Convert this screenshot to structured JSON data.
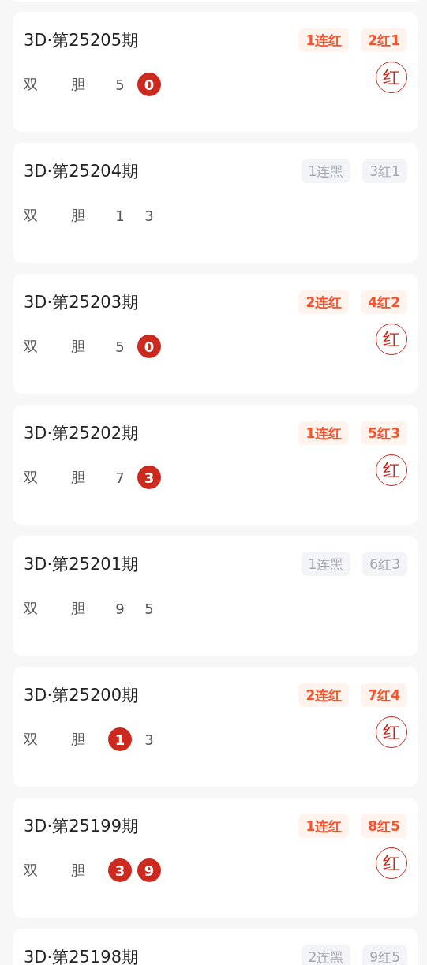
{
  "draws": [
    {
      "title": "3D·第25205期",
      "tags": [
        {
          "text": "1连红",
          "hit": true
        },
        {
          "text": "2红1",
          "hit": true
        }
      ],
      "labels": [
        "双",
        "胆"
      ],
      "numbers": [
        {
          "value": "5",
          "hit": false
        },
        {
          "value": "0",
          "hit": true
        }
      ],
      "result": "红"
    },
    {
      "title": "3D·第25204期",
      "tags": [
        {
          "text": "1连黑",
          "hit": false
        },
        {
          "text": "3红1",
          "hit": false
        }
      ],
      "labels": [
        "双",
        "胆"
      ],
      "numbers": [
        {
          "value": "1",
          "hit": false
        },
        {
          "value": "3",
          "hit": false
        }
      ]
    },
    {
      "title": "3D·第25203期",
      "tags": [
        {
          "text": "2连红",
          "hit": true
        },
        {
          "text": "4红2",
          "hit": true
        }
      ],
      "labels": [
        "双",
        "胆"
      ],
      "numbers": [
        {
          "value": "5",
          "hit": false
        },
        {
          "value": "0",
          "hit": true
        }
      ],
      "result": "红"
    },
    {
      "title": "3D·第25202期",
      "tags": [
        {
          "text": "1连红",
          "hit": true
        },
        {
          "text": "5红3",
          "hit": true
        }
      ],
      "labels": [
        "双",
        "胆"
      ],
      "numbers": [
        {
          "value": "7",
          "hit": false
        },
        {
          "value": "3",
          "hit": true
        }
      ],
      "result": "红"
    },
    {
      "title": "3D·第25201期",
      "tags": [
        {
          "text": "1连黑",
          "hit": false
        },
        {
          "text": "6红3",
          "hit": false
        }
      ],
      "labels": [
        "双",
        "胆"
      ],
      "numbers": [
        {
          "value": "9",
          "hit": false
        },
        {
          "value": "5",
          "hit": false
        }
      ]
    },
    {
      "title": "3D·第25200期",
      "tags": [
        {
          "text": "2连红",
          "hit": true
        },
        {
          "text": "7红4",
          "hit": true
        }
      ],
      "labels": [
        "双",
        "胆"
      ],
      "numbers": [
        {
          "value": "1",
          "hit": true
        },
        {
          "value": "3",
          "hit": false
        }
      ],
      "result": "红"
    },
    {
      "title": "3D·第25199期",
      "tags": [
        {
          "text": "1连红",
          "hit": true
        },
        {
          "text": "8红5",
          "hit": true
        }
      ],
      "labels": [
        "双",
        "胆"
      ],
      "numbers": [
        {
          "value": "3",
          "hit": true
        },
        {
          "value": "9",
          "hit": true
        }
      ],
      "result": "红"
    },
    {
      "title": "3D·第25198期",
      "tags": [
        {
          "text": "2连黑",
          "hit": false
        },
        {
          "text": "9红5",
          "hit": false
        }
      ]
    }
  ]
}
